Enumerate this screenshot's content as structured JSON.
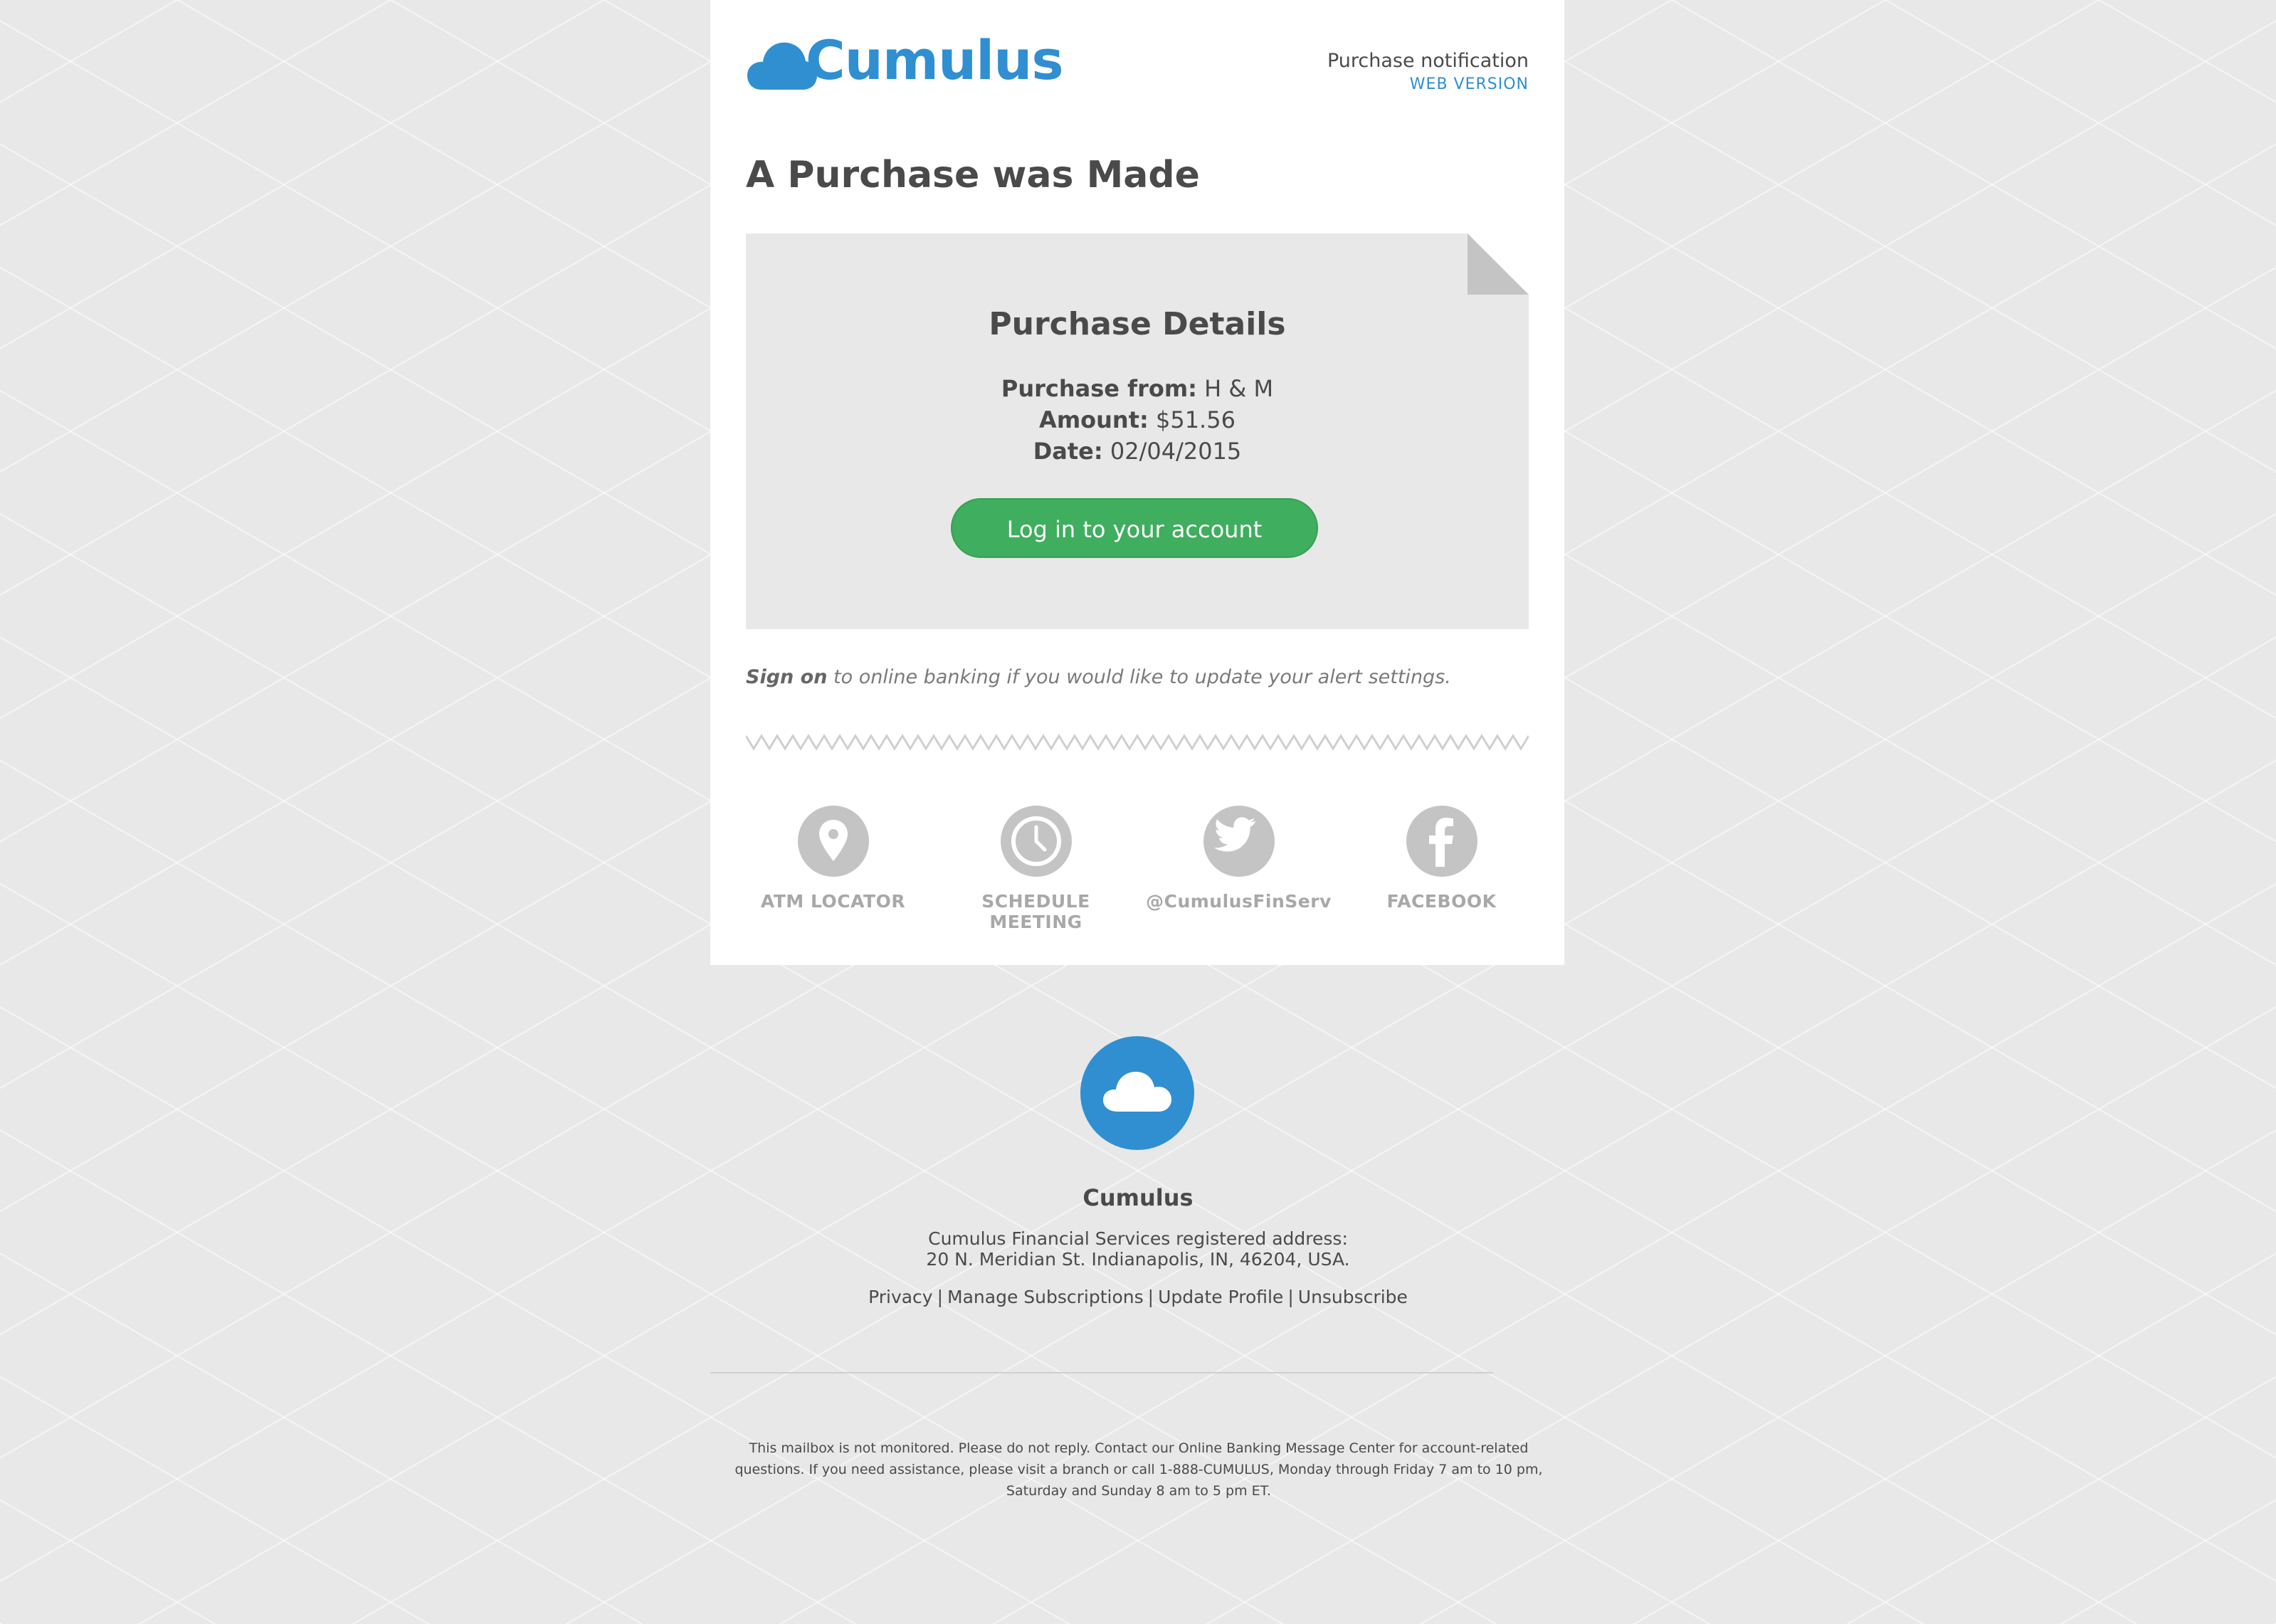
{
  "brand": {
    "name": "Cumulus",
    "accent_color": "#2f8fd1"
  },
  "header": {
    "notification_label": "Purchase notification",
    "web_version_link": "WEB VERSION"
  },
  "headline": "A Purchase was Made",
  "purchase": {
    "title": "Purchase Details",
    "from_label": "Purchase from:",
    "from_value": "H & M",
    "amount_label": "Amount:",
    "amount_value": "$51.56",
    "date_label": "Date:",
    "date_value": "02/04/2015",
    "button_label": "Log in to your account",
    "button_color": "#3fae5e"
  },
  "signon": {
    "link_text": "Sign on",
    "rest_text": "to online banking if you would like to update your alert settings."
  },
  "social": [
    {
      "icon": "map-pin-icon",
      "label": "ATM LOCATOR"
    },
    {
      "icon": "clock-icon",
      "label": "SCHEDULE MEETING"
    },
    {
      "icon": "twitter-bird-icon",
      "label": "@CumulusFinServ"
    },
    {
      "icon": "facebook-f-icon",
      "label": "FACEBOOK"
    }
  ],
  "footer": {
    "brand": "Cumulus",
    "address_line1": "Cumulus Financial Services registered address:",
    "address_line2": "20 N. Meridian St. Indianapolis, IN, 46204, USA.",
    "links": [
      "Privacy",
      "Manage Subscriptions",
      "Update Profile",
      "Unsubscribe"
    ],
    "disclaimer_line1": "This mailbox is not monitored. Please do not reply. Contact our Online Banking Message Center for account-related",
    "disclaimer_line2": "questions. If you need assistance, please visit a branch or call 1-888-CUMULUS, Monday through Friday 7 am to 10 pm,",
    "disclaimer_line3": "Saturday and Sunday 8 am to 5 pm ET."
  }
}
